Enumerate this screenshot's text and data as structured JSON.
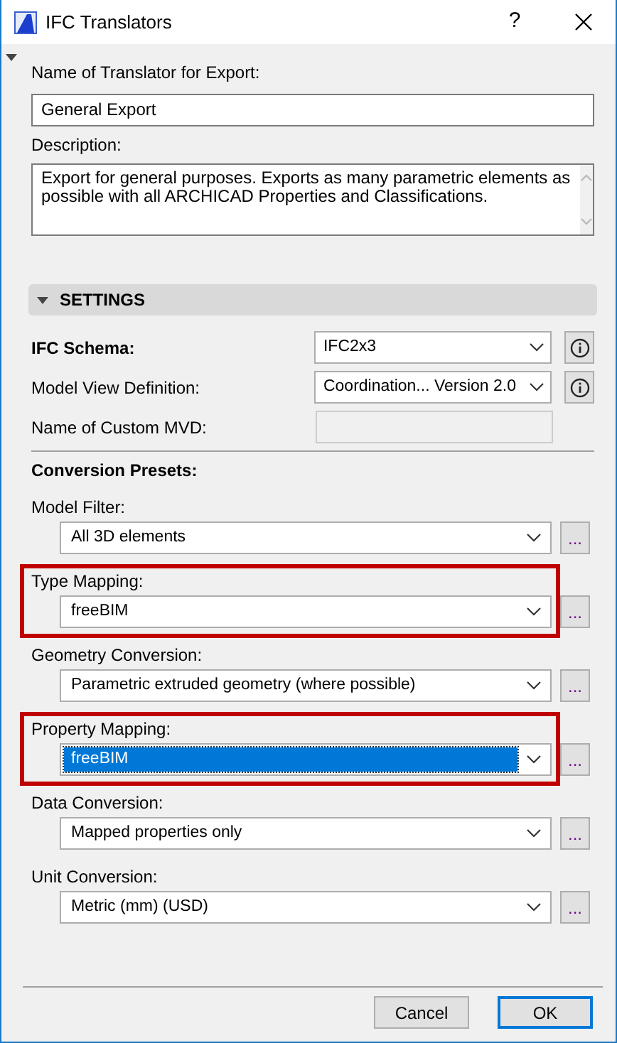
{
  "window": {
    "title": "IFC Translators",
    "help": "?"
  },
  "name_field": {
    "label": "Name of Translator for Export:",
    "value": "General Export"
  },
  "description": {
    "label": "Description:",
    "value": "Export for general purposes. Exports as many parametric elements as possible with all ARCHICAD Properties and Classifications."
  },
  "settings": {
    "title": "SETTINGS",
    "expanded": true
  },
  "schema_rows": [
    {
      "label": "IFC Schema:",
      "bold": true,
      "kind": "select",
      "value": "IFC2x3",
      "info": true
    },
    {
      "label": "Model View Definition:",
      "bold": false,
      "kind": "select",
      "value": "Coordination... Version 2.0",
      "info": true
    },
    {
      "label": "Name of Custom MVD:",
      "bold": false,
      "kind": "disabled-field",
      "info": false
    }
  ],
  "presets_title": "Conversion Presets:",
  "presets": [
    {
      "label": "Model Filter:",
      "value": "All 3D elements",
      "highlighted": false,
      "focused": false,
      "more": "..."
    },
    {
      "label": "Type Mapping:",
      "value": "freeBIM",
      "highlighted": true,
      "focused": false,
      "more": "..."
    },
    {
      "label": "Geometry Conversion:",
      "value": "Parametric extruded geometry (where possible)",
      "highlighted": false,
      "focused": false,
      "more": "..."
    },
    {
      "label": "Property Mapping:",
      "value": "freeBIM",
      "highlighted": true,
      "focused": true,
      "more": "..."
    },
    {
      "label": "Data Conversion:",
      "value": "Mapped properties only",
      "highlighted": false,
      "focused": false,
      "more": "..."
    },
    {
      "label": "Unit Conversion:",
      "value": "Metric (mm) (USD)",
      "highlighted": false,
      "focused": false,
      "more": "..."
    }
  ],
  "buttons": [
    {
      "label": "Cancel",
      "default": false
    },
    {
      "label": "OK",
      "default": true
    }
  ]
}
